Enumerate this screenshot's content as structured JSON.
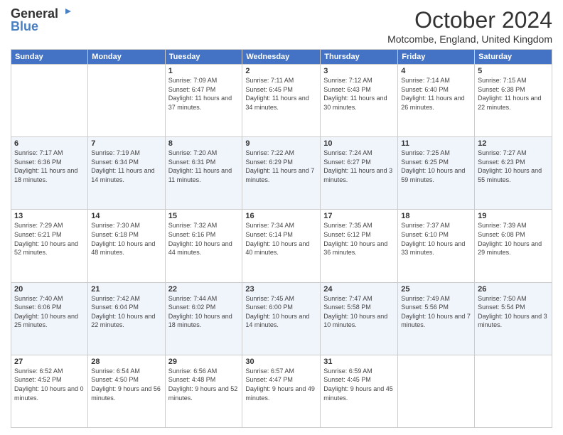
{
  "header": {
    "logo_general": "General",
    "logo_blue": "Blue",
    "month": "October 2024",
    "location": "Motcombe, England, United Kingdom"
  },
  "days_of_week": [
    "Sunday",
    "Monday",
    "Tuesday",
    "Wednesday",
    "Thursday",
    "Friday",
    "Saturday"
  ],
  "weeks": [
    [
      {
        "day": "",
        "sunrise": "",
        "sunset": "",
        "daylight": ""
      },
      {
        "day": "",
        "sunrise": "",
        "sunset": "",
        "daylight": ""
      },
      {
        "day": "1",
        "sunrise": "Sunrise: 7:09 AM",
        "sunset": "Sunset: 6:47 PM",
        "daylight": "Daylight: 11 hours and 37 minutes."
      },
      {
        "day": "2",
        "sunrise": "Sunrise: 7:11 AM",
        "sunset": "Sunset: 6:45 PM",
        "daylight": "Daylight: 11 hours and 34 minutes."
      },
      {
        "day": "3",
        "sunrise": "Sunrise: 7:12 AM",
        "sunset": "Sunset: 6:43 PM",
        "daylight": "Daylight: 11 hours and 30 minutes."
      },
      {
        "day": "4",
        "sunrise": "Sunrise: 7:14 AM",
        "sunset": "Sunset: 6:40 PM",
        "daylight": "Daylight: 11 hours and 26 minutes."
      },
      {
        "day": "5",
        "sunrise": "Sunrise: 7:15 AM",
        "sunset": "Sunset: 6:38 PM",
        "daylight": "Daylight: 11 hours and 22 minutes."
      }
    ],
    [
      {
        "day": "6",
        "sunrise": "Sunrise: 7:17 AM",
        "sunset": "Sunset: 6:36 PM",
        "daylight": "Daylight: 11 hours and 18 minutes."
      },
      {
        "day": "7",
        "sunrise": "Sunrise: 7:19 AM",
        "sunset": "Sunset: 6:34 PM",
        "daylight": "Daylight: 11 hours and 14 minutes."
      },
      {
        "day": "8",
        "sunrise": "Sunrise: 7:20 AM",
        "sunset": "Sunset: 6:31 PM",
        "daylight": "Daylight: 11 hours and 11 minutes."
      },
      {
        "day": "9",
        "sunrise": "Sunrise: 7:22 AM",
        "sunset": "Sunset: 6:29 PM",
        "daylight": "Daylight: 11 hours and 7 minutes."
      },
      {
        "day": "10",
        "sunrise": "Sunrise: 7:24 AM",
        "sunset": "Sunset: 6:27 PM",
        "daylight": "Daylight: 11 hours and 3 minutes."
      },
      {
        "day": "11",
        "sunrise": "Sunrise: 7:25 AM",
        "sunset": "Sunset: 6:25 PM",
        "daylight": "Daylight: 10 hours and 59 minutes."
      },
      {
        "day": "12",
        "sunrise": "Sunrise: 7:27 AM",
        "sunset": "Sunset: 6:23 PM",
        "daylight": "Daylight: 10 hours and 55 minutes."
      }
    ],
    [
      {
        "day": "13",
        "sunrise": "Sunrise: 7:29 AM",
        "sunset": "Sunset: 6:21 PM",
        "daylight": "Daylight: 10 hours and 52 minutes."
      },
      {
        "day": "14",
        "sunrise": "Sunrise: 7:30 AM",
        "sunset": "Sunset: 6:18 PM",
        "daylight": "Daylight: 10 hours and 48 minutes."
      },
      {
        "day": "15",
        "sunrise": "Sunrise: 7:32 AM",
        "sunset": "Sunset: 6:16 PM",
        "daylight": "Daylight: 10 hours and 44 minutes."
      },
      {
        "day": "16",
        "sunrise": "Sunrise: 7:34 AM",
        "sunset": "Sunset: 6:14 PM",
        "daylight": "Daylight: 10 hours and 40 minutes."
      },
      {
        "day": "17",
        "sunrise": "Sunrise: 7:35 AM",
        "sunset": "Sunset: 6:12 PM",
        "daylight": "Daylight: 10 hours and 36 minutes."
      },
      {
        "day": "18",
        "sunrise": "Sunrise: 7:37 AM",
        "sunset": "Sunset: 6:10 PM",
        "daylight": "Daylight: 10 hours and 33 minutes."
      },
      {
        "day": "19",
        "sunrise": "Sunrise: 7:39 AM",
        "sunset": "Sunset: 6:08 PM",
        "daylight": "Daylight: 10 hours and 29 minutes."
      }
    ],
    [
      {
        "day": "20",
        "sunrise": "Sunrise: 7:40 AM",
        "sunset": "Sunset: 6:06 PM",
        "daylight": "Daylight: 10 hours and 25 minutes."
      },
      {
        "day": "21",
        "sunrise": "Sunrise: 7:42 AM",
        "sunset": "Sunset: 6:04 PM",
        "daylight": "Daylight: 10 hours and 22 minutes."
      },
      {
        "day": "22",
        "sunrise": "Sunrise: 7:44 AM",
        "sunset": "Sunset: 6:02 PM",
        "daylight": "Daylight: 10 hours and 18 minutes."
      },
      {
        "day": "23",
        "sunrise": "Sunrise: 7:45 AM",
        "sunset": "Sunset: 6:00 PM",
        "daylight": "Daylight: 10 hours and 14 minutes."
      },
      {
        "day": "24",
        "sunrise": "Sunrise: 7:47 AM",
        "sunset": "Sunset: 5:58 PM",
        "daylight": "Daylight: 10 hours and 10 minutes."
      },
      {
        "day": "25",
        "sunrise": "Sunrise: 7:49 AM",
        "sunset": "Sunset: 5:56 PM",
        "daylight": "Daylight: 10 hours and 7 minutes."
      },
      {
        "day": "26",
        "sunrise": "Sunrise: 7:50 AM",
        "sunset": "Sunset: 5:54 PM",
        "daylight": "Daylight: 10 hours and 3 minutes."
      }
    ],
    [
      {
        "day": "27",
        "sunrise": "Sunrise: 6:52 AM",
        "sunset": "Sunset: 4:52 PM",
        "daylight": "Daylight: 10 hours and 0 minutes."
      },
      {
        "day": "28",
        "sunrise": "Sunrise: 6:54 AM",
        "sunset": "Sunset: 4:50 PM",
        "daylight": "Daylight: 9 hours and 56 minutes."
      },
      {
        "day": "29",
        "sunrise": "Sunrise: 6:56 AM",
        "sunset": "Sunset: 4:48 PM",
        "daylight": "Daylight: 9 hours and 52 minutes."
      },
      {
        "day": "30",
        "sunrise": "Sunrise: 6:57 AM",
        "sunset": "Sunset: 4:47 PM",
        "daylight": "Daylight: 9 hours and 49 minutes."
      },
      {
        "day": "31",
        "sunrise": "Sunrise: 6:59 AM",
        "sunset": "Sunset: 4:45 PM",
        "daylight": "Daylight: 9 hours and 45 minutes."
      },
      {
        "day": "",
        "sunrise": "",
        "sunset": "",
        "daylight": ""
      },
      {
        "day": "",
        "sunrise": "",
        "sunset": "",
        "daylight": ""
      }
    ]
  ]
}
